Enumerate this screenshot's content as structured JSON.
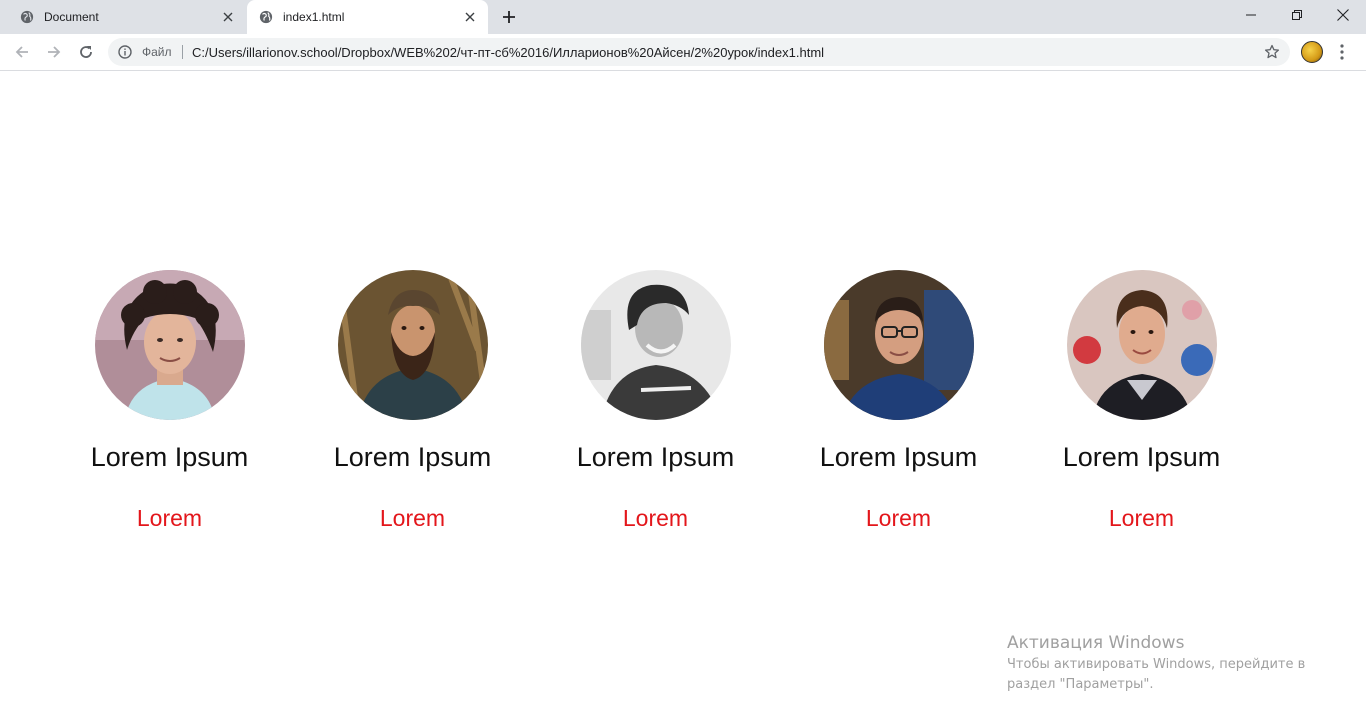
{
  "browser": {
    "tabs": [
      {
        "title": "Document",
        "active": false
      },
      {
        "title": "index1.html",
        "active": true
      }
    ],
    "address": {
      "scheme_label": "Файл",
      "url": "C:/Users/illarionov.school/Dropbox/WEB%202/чт-пт-сб%2016/Илларионов%20Айсен/2%20урок/index1.html"
    },
    "icons": {
      "back": "arrow-left-icon",
      "forward": "arrow-right-icon",
      "reload": "reload-icon",
      "bookmark": "star-icon",
      "menu": "three-dots-icon"
    }
  },
  "page": {
    "members": [
      {
        "name": "Lorem Ipsum",
        "role": "Lorem",
        "photo": "curly-hair-man-portrait"
      },
      {
        "name": "Lorem Ipsum",
        "role": "Lorem",
        "photo": "bearded-man-portrait"
      },
      {
        "name": "Lorem Ipsum",
        "role": "Lorem",
        "photo": "bw-smiling-man-portrait"
      },
      {
        "name": "Lorem Ipsum",
        "role": "Lorem",
        "photo": "man-with-glasses-portrait"
      },
      {
        "name": "Lorem Ipsum",
        "role": "Lorem",
        "photo": "young-man-plaid-shirt-portrait"
      }
    ],
    "role_color": "#e3161b"
  },
  "windows_activation": {
    "title": "Активация Windows",
    "body": "Чтобы активировать Windows, перейдите в раздел \"Параметры\"."
  }
}
